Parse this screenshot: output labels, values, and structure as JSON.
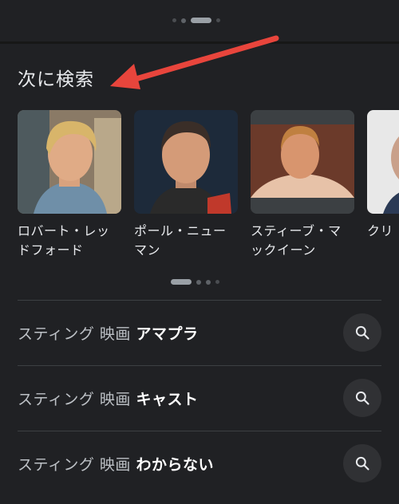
{
  "header": {
    "section_title": "次に検索"
  },
  "people": [
    {
      "name": "ロバート・レッドフォード"
    },
    {
      "name": "ポール・ニューマン"
    },
    {
      "name": "スティーブ・マックイーン"
    },
    {
      "name": "クリ スト"
    }
  ],
  "related_searches": [
    {
      "prefix": "スティング 映画",
      "suffix": "アマプラ",
      "icon": "search-icon"
    },
    {
      "prefix": "スティング 映画",
      "suffix": "キャスト",
      "icon": "search-icon"
    },
    {
      "prefix": "スティング 映画",
      "suffix": "わからない",
      "icon": "search-icon"
    }
  ],
  "colors": {
    "background": "#202124",
    "arrow": "#e8453c",
    "text_primary": "#e8eaed",
    "text_secondary": "#bdc1c6"
  }
}
